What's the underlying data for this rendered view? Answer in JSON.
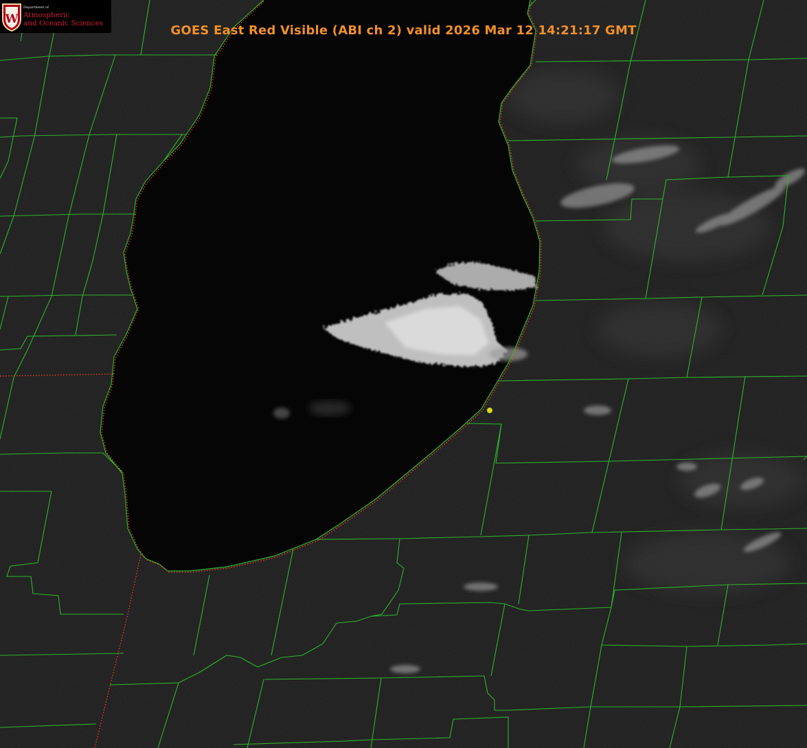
{
  "header": {
    "title": "GOES East Red Visible (ABI ch 2) valid 2026 Mar 12 14:21:17 GMT"
  },
  "logo": {
    "department": "Department of",
    "line1": "Atmospheric",
    "line2": "and Oceanic Sciences",
    "crest_letter": "W"
  },
  "colors": {
    "title": "#f0902a",
    "county_border": "#2db52d",
    "state_border": "#ff3b1f",
    "marker": "#d8d81a",
    "logo_text": "#d21f3c",
    "lake": "#050505",
    "land": "#191919",
    "cloud": "#dcdcdc"
  },
  "marker": {
    "name": "station-marker",
    "icon": "dot-icon"
  }
}
